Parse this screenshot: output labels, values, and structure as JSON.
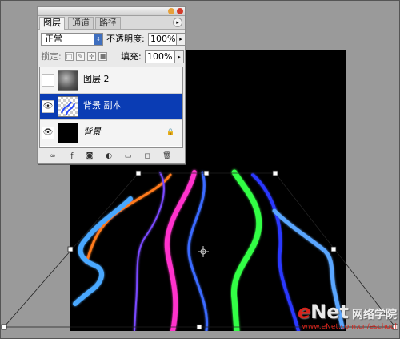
{
  "layers_panel": {
    "tabs": [
      {
        "label": "图层",
        "active": true
      },
      {
        "label": "通道",
        "active": false
      },
      {
        "label": "路径",
        "active": false
      }
    ],
    "blend_mode": "正常",
    "opacity_label": "不透明度:",
    "opacity_value": "100%",
    "lock_label": "锁定:",
    "fill_label": "填充:",
    "fill_value": "100%",
    "layers": [
      {
        "name": "图层 2",
        "visible": false,
        "selected": false,
        "thumb": "gray"
      },
      {
        "name": "背景 副本",
        "visible": true,
        "selected": true,
        "thumb": "checker"
      },
      {
        "name": "背景",
        "visible": true,
        "selected": false,
        "thumb": "black",
        "locked": true
      }
    ],
    "bottom_icons": [
      "link-icon",
      "layer-style-icon",
      "mask-icon",
      "adjustment-layer-icon",
      "group-folder-icon",
      "new-layer-icon",
      "trash-icon"
    ]
  },
  "canvas": {
    "background": "#000000",
    "stroke_colors": [
      "#ff7a1a",
      "#4aa8ff",
      "#ff33cc",
      "#3355ff",
      "#33ff44",
      "#2c38ff",
      "#5aa6ff"
    ],
    "transform_icon": "crosshair-icon"
  },
  "watermark": {
    "brand_red": "e",
    "brand_rest": "Net",
    "brand_cn": "网络学院",
    "url": "www.eNet.com.cn/eschool"
  },
  "colors": {
    "selection": "#0a3cb4",
    "brand_red": "#d8231b"
  }
}
